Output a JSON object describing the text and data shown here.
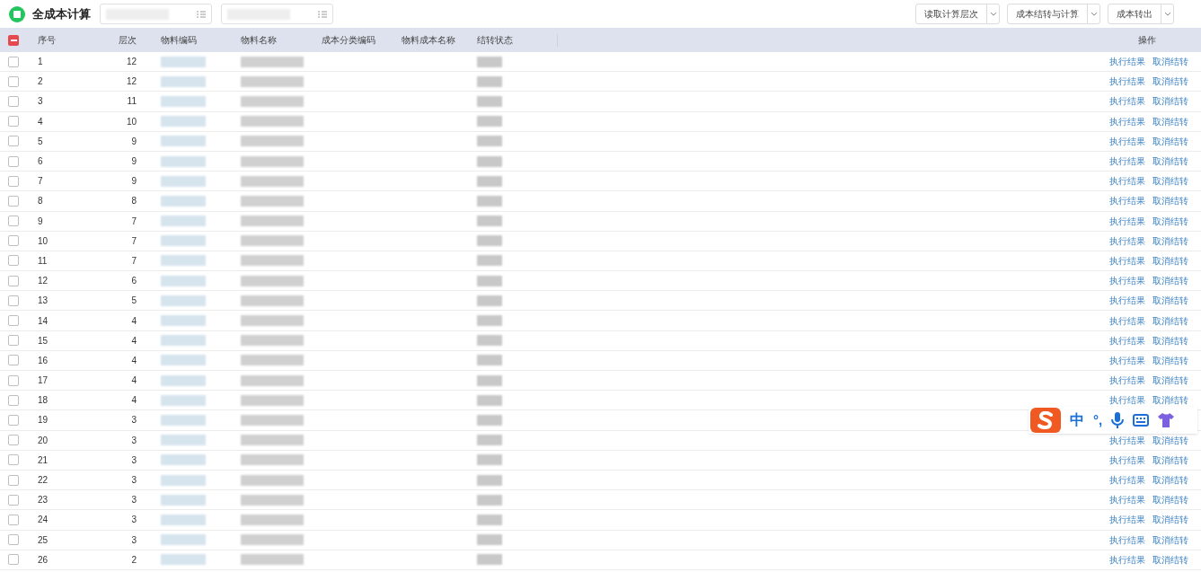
{
  "app": {
    "title": "全成本计算"
  },
  "toolbar": [
    {
      "label": "读取计算层次"
    },
    {
      "label": "成本结转与计算"
    },
    {
      "label": "成本转出"
    }
  ],
  "table": {
    "select_all": {
      "indeterminate": true
    },
    "columns": [
      "序号",
      "层次",
      "物料编码",
      "物料名称",
      "成本分类编码",
      "物料成本名称",
      "结转状态",
      "操作"
    ],
    "rows": [
      {
        "seq": "1",
        "level": "12",
        "checked": false,
        "actions": [
          "执行结果",
          "取消结转"
        ]
      },
      {
        "seq": "2",
        "level": "12",
        "checked": false,
        "actions": [
          "执行结果",
          "取消结转"
        ]
      },
      {
        "seq": "3",
        "level": "11",
        "checked": false,
        "actions": [
          "执行结果",
          "取消结转"
        ]
      },
      {
        "seq": "4",
        "level": "10",
        "checked": false,
        "actions": [
          "执行结果",
          "取消结转"
        ]
      },
      {
        "seq": "5",
        "level": "9",
        "checked": false,
        "actions": [
          "执行结果",
          "取消结转"
        ]
      },
      {
        "seq": "6",
        "level": "9",
        "checked": false,
        "actions": [
          "执行结果",
          "取消结转"
        ]
      },
      {
        "seq": "7",
        "level": "9",
        "checked": false,
        "actions": [
          "执行结果",
          "取消结转"
        ]
      },
      {
        "seq": "8",
        "level": "8",
        "checked": false,
        "actions": [
          "执行结果",
          "取消结转"
        ]
      },
      {
        "seq": "9",
        "level": "7",
        "checked": false,
        "actions": [
          "执行结果",
          "取消结转"
        ]
      },
      {
        "seq": "10",
        "level": "7",
        "checked": false,
        "actions": [
          "执行结果",
          "取消结转"
        ]
      },
      {
        "seq": "11",
        "level": "7",
        "checked": false,
        "actions": [
          "执行结果",
          "取消结转"
        ]
      },
      {
        "seq": "12",
        "level": "6",
        "checked": false,
        "actions": [
          "执行结果",
          "取消结转"
        ]
      },
      {
        "seq": "13",
        "level": "5",
        "checked": false,
        "actions": [
          "执行结果",
          "取消结转"
        ]
      },
      {
        "seq": "14",
        "level": "4",
        "checked": false,
        "actions": [
          "执行结果",
          "取消结转"
        ]
      },
      {
        "seq": "15",
        "level": "4",
        "checked": false,
        "actions": [
          "执行结果",
          "取消结转"
        ]
      },
      {
        "seq": "16",
        "level": "4",
        "checked": false,
        "actions": [
          "执行结果",
          "取消结转"
        ]
      },
      {
        "seq": "17",
        "level": "4",
        "checked": false,
        "actions": [
          "执行结果",
          "取消结转"
        ]
      },
      {
        "seq": "18",
        "level": "4",
        "checked": false,
        "actions": [
          "执行结果",
          "取消结转"
        ]
      },
      {
        "seq": "19",
        "level": "3",
        "checked": false,
        "actions": []
      },
      {
        "seq": "20",
        "level": "3",
        "checked": false,
        "actions": [
          "执行结果",
          "取消结转"
        ]
      },
      {
        "seq": "21",
        "level": "3",
        "checked": false,
        "actions": [
          "执行结果",
          "取消结转"
        ]
      },
      {
        "seq": "22",
        "level": "3",
        "checked": false,
        "actions": [
          "执行结果",
          "取消结转"
        ]
      },
      {
        "seq": "23",
        "level": "3",
        "checked": false,
        "actions": [
          "执行结果",
          "取消结转"
        ]
      },
      {
        "seq": "24",
        "level": "3",
        "checked": false,
        "actions": [
          "执行结果",
          "取消结转"
        ]
      },
      {
        "seq": "25",
        "level": "3",
        "checked": false,
        "actions": [
          "执行结果",
          "取消结转"
        ]
      },
      {
        "seq": "26",
        "level": "2",
        "checked": false,
        "actions": [
          "执行结果",
          "取消结转"
        ]
      }
    ]
  },
  "ime_toolbar": {
    "mode": "中",
    "punctuation": "°,"
  }
}
